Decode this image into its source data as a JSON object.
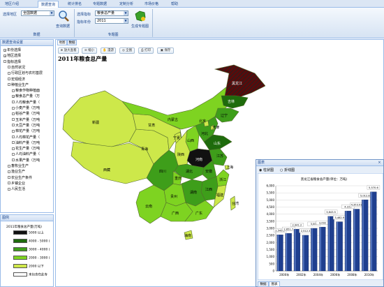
{
  "tabs": [
    "地区介绍",
    "数据查询",
    "统计排名",
    "专题数据",
    "定制分析",
    "市场价格",
    "帮助"
  ],
  "ribbon": {
    "select_area_label": "选择地区",
    "select_area_value": "全国数据",
    "query_button": "查询数据",
    "group_data": "数据",
    "select_indicator_label": "选择指标",
    "select_indicator_value": "粮食总产量",
    "indicator_year_label": "指标年份",
    "indicator_year_value": "2011",
    "generate_map_button": "生成专题图",
    "group_map": "专题图"
  },
  "tree_panel": {
    "title": "数据查询设置",
    "items": [
      {
        "label": "年份选择",
        "checked": true
      },
      {
        "label": "地区选择",
        "checked": true
      },
      {
        "label": "指标选择",
        "checked": false
      },
      {
        "label": "自然状况",
        "checked": false
      },
      {
        "label": "行政区划与农村基层",
        "checked": false
      },
      {
        "label": "宏观经济",
        "checked": false
      },
      {
        "label": "种植业生产",
        "checked": false
      },
      {
        "label": "粮食作物种植面",
        "checked": false
      },
      {
        "label": "粮食总产量（万",
        "checked": true
      },
      {
        "label": "人均粮食产量（",
        "checked": false
      },
      {
        "label": "小麦产量（万吨",
        "checked": false
      },
      {
        "label": "稻谷产量（万吨",
        "checked": false
      },
      {
        "label": "玉米产量（万吨",
        "checked": false
      },
      {
        "label": "大豆产量（万吨",
        "checked": false
      },
      {
        "label": "棉花产量（万吨",
        "checked": false
      },
      {
        "label": "人均棉花产量（",
        "checked": false
      },
      {
        "label": "油料产量（万吨",
        "checked": false
      },
      {
        "label": "花生产量（万吨",
        "checked": false
      },
      {
        "label": "人均油料产量（",
        "checked": false
      },
      {
        "label": "水果产量（万吨",
        "checked": false
      },
      {
        "label": "畜牧业生产",
        "checked": false
      },
      {
        "label": "渔业生产",
        "checked": false
      },
      {
        "label": "农业生产条件",
        "checked": false
      },
      {
        "label": "乡镇企业",
        "checked": false
      },
      {
        "label": "人民生活",
        "checked": false
      }
    ]
  },
  "legend_panel": {
    "title": "图例",
    "heading": "2011年粮食总产量(万吨)",
    "rows": [
      {
        "label": "5000 以上",
        "color": "#111111"
      },
      {
        "label": "4000 - 5000 (",
        "color": "#1e6b0c"
      },
      {
        "label": "3000 - 4000 (",
        "color": "#3e9e1a"
      },
      {
        "label": "2000 - 3000 (",
        "color": "#7ed321"
      },
      {
        "label": "2000 以下",
        "color": "#cfe84a"
      },
      {
        "label": "未包含在此专",
        "color": "#ffffff"
      }
    ]
  },
  "map": {
    "tabs": [
      "地图",
      "数据"
    ],
    "toolbar": [
      "放大查看",
      "缩小",
      "漫游",
      "全图",
      "打印",
      "保存"
    ],
    "title": "2011年粮食总产量",
    "provinces": {
      "heilongjiang": "黑龙江",
      "jilin": "吉林",
      "liaoning": "辽宁",
      "neimenggu": "内蒙古",
      "beijing": "北京",
      "tianjin": "天津",
      "hebei": "河北",
      "shanxi": "山西",
      "shandong": "山东",
      "henan": "河南",
      "shaanxi": "陕西",
      "ningxia": "宁夏",
      "gansu": "甘肃",
      "qinghai": "青海",
      "xinjiang": "新疆",
      "xizang": "西藏",
      "sichuan": "四川",
      "chongqing": "重庆",
      "hubei": "湖北",
      "anhui": "安徽",
      "jiangsu": "江苏",
      "shanghai": "上海",
      "zhejiang": "浙江",
      "jiangxi": "江西",
      "hunan": "湖南",
      "guizhou": "贵州",
      "yunnan": "云南",
      "guangxi": "广西",
      "guangdong": "广东",
      "fujian": "福建",
      "taiwan": "台湾",
      "hainan": "海南"
    }
  },
  "chart_window": {
    "title": "图表",
    "radio_bar": "柱状图",
    "radio_line": "折线图",
    "bottom_tabs": [
      "数据",
      "图表"
    ]
  },
  "chart_data": {
    "type": "bar",
    "title": "黑龙江省粮食总产量(单位：万吨)",
    "categories": [
      "2000年",
      "2001年",
      "2002年",
      "2003年",
      "2004年",
      "2005年",
      "2006年",
      "2007年",
      "2008年",
      "2009年",
      "2010年",
      "2011年"
    ],
    "x_tick_labels": [
      "2000年",
      "2002年",
      "2004年",
      "2006年",
      "2008年",
      "2010年"
    ],
    "values": [
      2545.5,
      2651.7,
      2941.2,
      2512.3,
      3001,
      3092,
      3843.5,
      3462.9,
      4225,
      4353.01,
      5012.8,
      5570.6
    ],
    "value_labels": [
      "2,545.5",
      "2,651.7",
      "2,941.2",
      "2,512.3",
      "3,001",
      "3,092",
      "3,843.5",
      "3,462.9",
      "4,225",
      "4,353.01",
      "5,012.8",
      "5,570.6"
    ],
    "ylim": [
      0,
      6000
    ],
    "y_ticks": [
      "0",
      "500",
      "1,000",
      "1,500",
      "2,000",
      "2,500",
      "3,000",
      "3,500",
      "4,000",
      "4,500",
      "5,000",
      "5,500",
      "6,000"
    ],
    "grid": true,
    "bar_color": "#1f3f8f"
  }
}
